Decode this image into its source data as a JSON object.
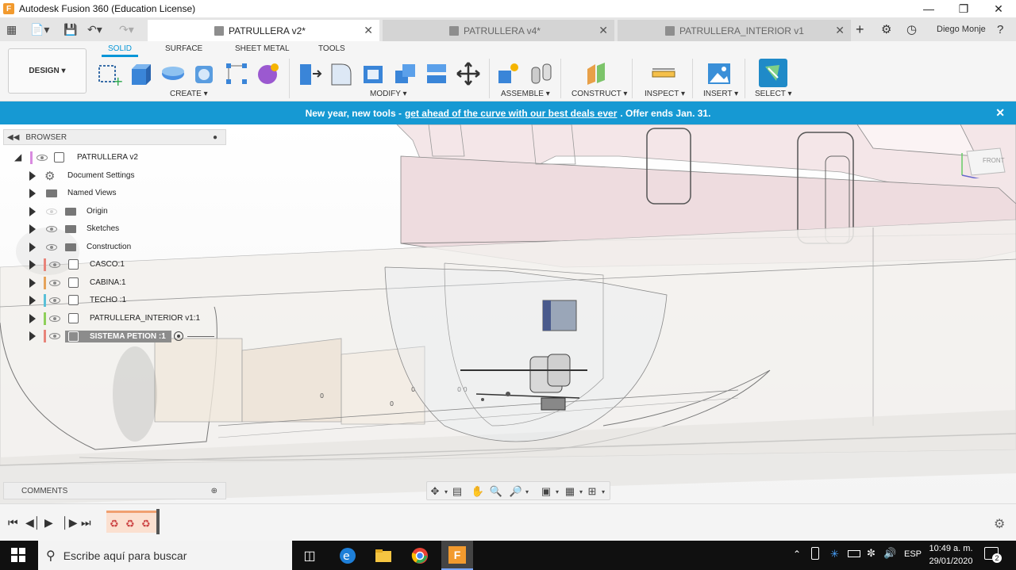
{
  "window": {
    "title": "Autodesk Fusion 360 (Education License)",
    "app_icon": "F",
    "controls": [
      "minimize-icon",
      "restore-icon",
      "close-icon"
    ]
  },
  "tabs": [
    {
      "label": "PATRULLERA v2*",
      "active": true
    },
    {
      "label": "PATRULLERA v4*",
      "active": false
    },
    {
      "label": "PATRULLERA_INTERIOR v1",
      "active": false
    }
  ],
  "user": {
    "name": "Diego Monje"
  },
  "toolbar": {
    "workspace": "DESIGN",
    "workspace_tabs": [
      {
        "label": "SOLID",
        "active": true
      },
      {
        "label": "SURFACE",
        "active": false
      },
      {
        "label": "SHEET METAL",
        "active": false
      },
      {
        "label": "TOOLS",
        "active": false
      }
    ],
    "groups": {
      "create": "CREATE",
      "modify": "MODIFY",
      "assemble": "ASSEMBLE",
      "construct": "CONSTRUCT",
      "inspect": "INSPECT",
      "insert": "INSERT",
      "select": "SELECT"
    }
  },
  "banner": {
    "prefix": "New year, new tools -",
    "link": "get ahead of the curve with our best deals ever",
    "suffix": ". Offer ends Jan. 31."
  },
  "browser": {
    "title": "BROWSER",
    "root": "PATRULLERA v2",
    "items": [
      {
        "label": "Document Settings",
        "icon": "gear-icon"
      },
      {
        "label": "Named Views",
        "icon": "folder-icon"
      },
      {
        "label": "Origin",
        "icon": "folder-icon"
      },
      {
        "label": "Sketches",
        "icon": "folder-icon"
      },
      {
        "label": "Construction",
        "icon": "folder-icon"
      },
      {
        "label": "CASCO:1",
        "icon": "component-icon",
        "color": "#e8847a"
      },
      {
        "label": "CABINA:1",
        "icon": "component-icon",
        "color": "#e6a35a"
      },
      {
        "label": "TECHO :1",
        "icon": "component-icon",
        "color": "#5ac0d8"
      },
      {
        "label": "PATRULLERA_INTERIOR v1:1",
        "icon": "component-icon",
        "color": "#8fd05a"
      },
      {
        "label": "SISTEMA PETION :1",
        "icon": "component-icon",
        "color": "#e8847a",
        "selected": true
      }
    ]
  },
  "comments": {
    "title": "COMMENTS"
  },
  "viewcube": {
    "label": "FRONT"
  },
  "taskbar": {
    "search_placeholder": "Escribe aquí para buscar",
    "language": "ESP",
    "time": "10:49 a. m.",
    "date": "29/01/2020",
    "notifications": "2"
  },
  "colors": {
    "accent": "#0696d7",
    "banner": "#1699d3",
    "taskbar": "#101010"
  }
}
